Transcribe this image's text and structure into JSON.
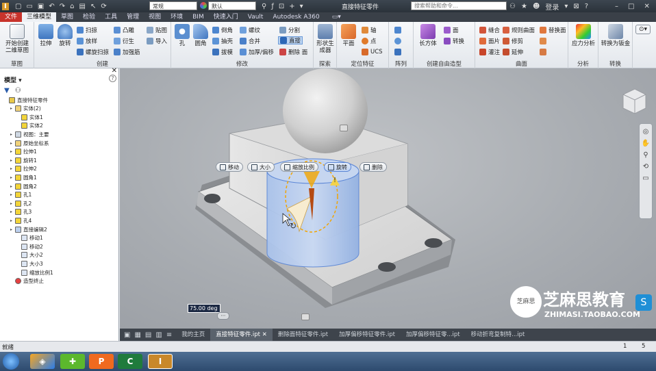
{
  "titlebar": {
    "app_icon": "I",
    "style_combo": "常规",
    "material_combo": "默认",
    "title": "直接特征零件",
    "search_placeholder": "搜索帮助和命令...",
    "login": "登录"
  },
  "ribbon_tabs": [
    "文件",
    "三维模型",
    "草图",
    "检验",
    "工具",
    "管理",
    "视图",
    "环境",
    "BIM",
    "快速入门",
    "Vault",
    "Autodesk A360"
  ],
  "active_tab": "三维模型",
  "ribbon": {
    "sketch_panel": {
      "label": "草图",
      "start_sketch": "开始创建二维草图"
    },
    "create_panel": {
      "label": "创建",
      "extrude": "拉伸",
      "revolve": "旋转",
      "sweep": "扫掠",
      "loft": "放样",
      "coil": "螺旋扫掠",
      "emboss": "凸雕",
      "derive": "衍生",
      "rib": "加强筋",
      "decal": "贴图",
      "import": "导入"
    },
    "modify_panel": {
      "label": "修改",
      "hole": "孔",
      "fillet": "圆角",
      "chamfer": "倒角",
      "shell": "抽壳",
      "draft": "拔模",
      "thread": "螺纹",
      "combine": "合并",
      "thicken": "加厚/偏移",
      "split": "分割",
      "direct": "直接",
      "delete_face": "删除 面"
    },
    "explore_panel": {
      "label": "探索",
      "shape_generator": "形状生成器"
    },
    "work_features_panel": {
      "label": "定位特征",
      "plane": "平面",
      "axis": "轴",
      "point": "点",
      "ucs": "UCS"
    },
    "pattern_panel": {
      "label": "阵列"
    },
    "freeform_panel": {
      "label": "创建自由造型",
      "box": "长方体",
      "face": "面",
      "convert": "转换"
    },
    "surface_panel": {
      "label": "曲面",
      "stitch": "缝合",
      "patch": "面片",
      "sculpt": "灌注",
      "ruled": "规则曲面",
      "trim": "修剪",
      "extend": "延伸",
      "replace_face": "替换面"
    },
    "analysis_panel": {
      "label": "分析",
      "stress": "应力分析"
    },
    "convert_panel": {
      "label": "转换",
      "to_sheetmetal": "转换为钣金"
    }
  },
  "browser": {
    "title": "模型",
    "tree": [
      {
        "label": "直接特征零件",
        "level": 0,
        "icon": "part-icon"
      },
      {
        "label": "实体(2)",
        "level": 1,
        "icon": "folder-icon"
      },
      {
        "label": "实体1",
        "level": 2,
        "icon": "solid-icon"
      },
      {
        "label": "实体2",
        "level": 2,
        "icon": "solid-icon"
      },
      {
        "label": "视图：主要",
        "level": 1,
        "icon": "view-icon"
      },
      {
        "label": "原始坐标系",
        "level": 1,
        "icon": "folder-icon"
      },
      {
        "label": "拉伸1",
        "level": 1,
        "icon": "extrude-icon"
      },
      {
        "label": "旋转1",
        "level": 1,
        "icon": "revolve-icon"
      },
      {
        "label": "拉伸2",
        "level": 1,
        "icon": "extrude-icon"
      },
      {
        "label": "圆角1",
        "level": 1,
        "icon": "fillet-icon"
      },
      {
        "label": "圆角2",
        "level": 1,
        "icon": "fillet-icon"
      },
      {
        "label": "孔1",
        "level": 1,
        "icon": "hole-icon"
      },
      {
        "label": "孔2",
        "level": 1,
        "icon": "hole-icon"
      },
      {
        "label": "孔3",
        "level": 1,
        "icon": "hole-icon"
      },
      {
        "label": "孔4",
        "level": 1,
        "icon": "hole-icon"
      },
      {
        "label": "直接编辑2",
        "level": 1,
        "icon": "direct-edit-icon"
      },
      {
        "label": "移动1",
        "level": 2,
        "icon": "move-icon"
      },
      {
        "label": "移动2",
        "level": 2,
        "icon": "move-icon"
      },
      {
        "label": "大小2",
        "level": 2,
        "icon": "size-icon"
      },
      {
        "label": "大小3",
        "level": 2,
        "icon": "size-icon"
      },
      {
        "label": "缩放比例1",
        "level": 2,
        "icon": "scale-icon"
      },
      {
        "label": "造型终止",
        "level": 1,
        "icon": "end-of-part-icon"
      }
    ]
  },
  "minitoolbar": {
    "move": "移动",
    "size": "大小",
    "scale": "缩放比例",
    "rotate": "旋转",
    "delete": "删除"
  },
  "angle_input": "75.00 deg",
  "doc_tabs": [
    "我的主页",
    "直接特征零件.ipt",
    "删除面特征零件.ipt",
    "加厚偏移特征零件.ipt",
    "加厚偏移特征零...ipt",
    "移动折弯复制特...ipt"
  ],
  "active_doc_tab": 1,
  "status": {
    "text": "就绪",
    "num1": "1",
    "num2": "5"
  },
  "watermark": {
    "brand": "芝麻思教育",
    "url": "ZHIMASI.TAOBAO.COM",
    "logo_text": "芝麻思"
  },
  "colors": {
    "accent_file": "#c8332b",
    "selection_blue": "#8fb2e8",
    "rotate_orange": "#f2a500"
  }
}
